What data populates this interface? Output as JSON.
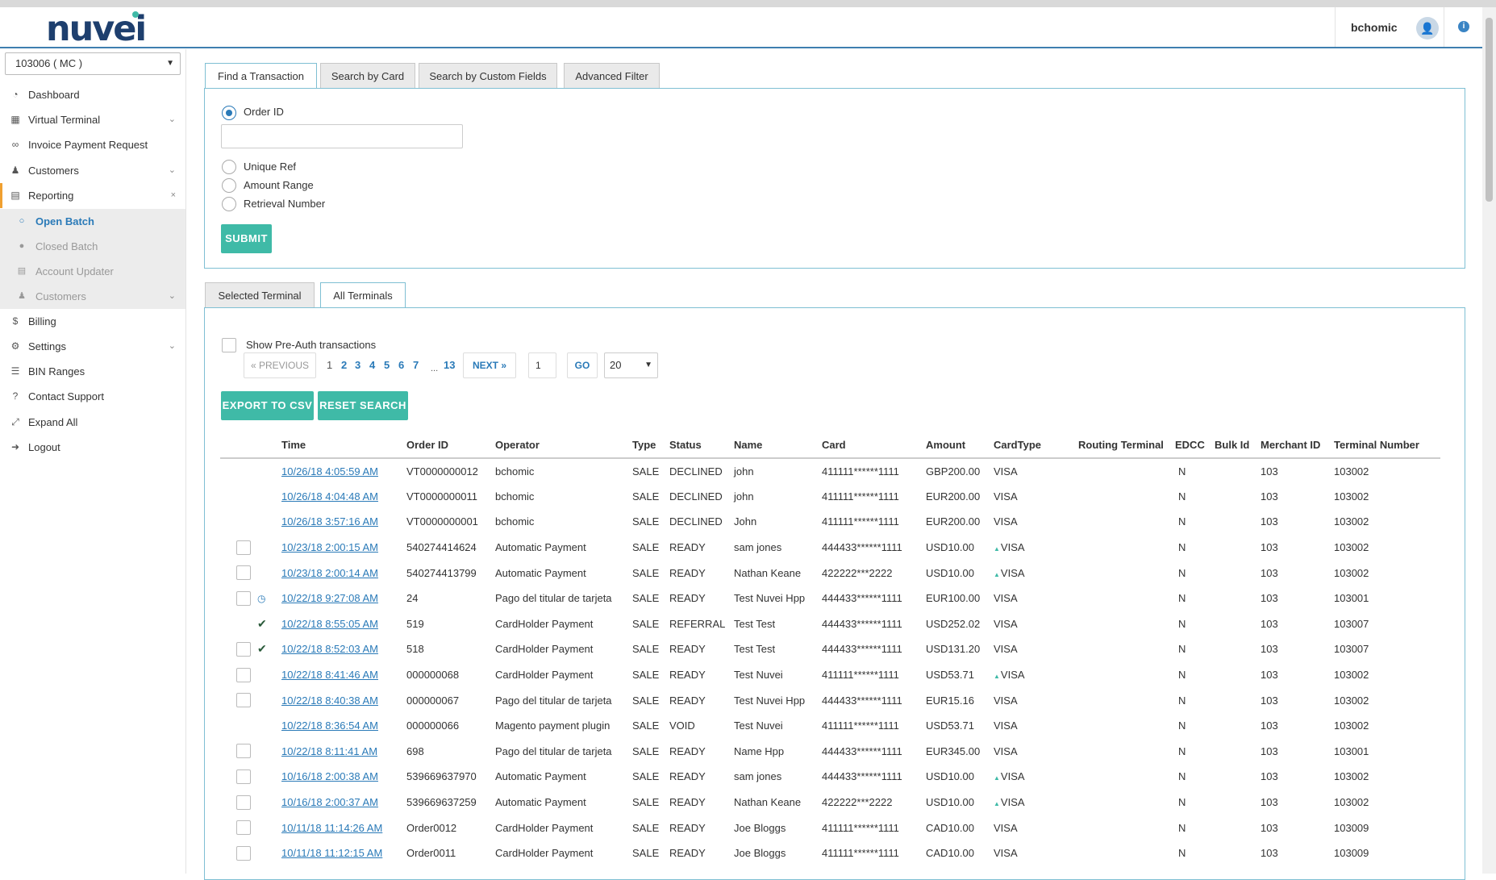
{
  "header": {
    "logo": "nuvei",
    "username": "bchomic"
  },
  "sidebar": {
    "merchant": "103006 ( MC )",
    "items": [
      {
        "label": "Dashboard",
        "icon": "dashboard-icon"
      },
      {
        "label": "Virtual Terminal",
        "icon": "calculator-icon"
      },
      {
        "label": "Invoice Payment Request",
        "icon": "link-icon"
      },
      {
        "label": "Customers",
        "icon": "users-icon"
      },
      {
        "label": "Reporting",
        "icon": "report-icon"
      },
      {
        "label": "Billing",
        "icon": "dollar-icon"
      },
      {
        "label": "Settings",
        "icon": "gears-icon"
      },
      {
        "label": "BIN Ranges",
        "icon": "list-icon"
      },
      {
        "label": "Contact Support",
        "icon": "help-icon"
      },
      {
        "label": "Expand All",
        "icon": "expand-icon"
      },
      {
        "label": "Logout",
        "icon": "logout-icon"
      }
    ],
    "reporting_sub": [
      {
        "label": "Open Batch"
      },
      {
        "label": "Closed Batch"
      },
      {
        "label": "Account Updater"
      },
      {
        "label": "Customers"
      }
    ]
  },
  "search": {
    "tabs": [
      "Find a Transaction",
      "Search by Card",
      "Search by Custom Fields",
      "Advanced Filter"
    ],
    "options": [
      "Order ID",
      "Unique Ref",
      "Amount Range",
      "Retrieval Number"
    ],
    "order_id_value": "",
    "submit": "SUBMIT"
  },
  "results": {
    "tabs": [
      "Selected Terminal",
      "All Terminals"
    ],
    "preauth_label": "Show Pre-Auth transactions",
    "pagination": {
      "previous": "« PREVIOUS",
      "pages": [
        "1",
        "2",
        "3",
        "4",
        "5",
        "6",
        "7"
      ],
      "ellipsis": "...",
      "last": "13",
      "next": "NEXT »",
      "page_input": "1",
      "go": "GO",
      "page_size": "20"
    },
    "export": "EXPORT TO CSV",
    "reset": "RESET SEARCH",
    "columns": [
      "Time",
      "Order ID",
      "Operator",
      "Type",
      "Status",
      "Name",
      "Card",
      "Amount",
      "CardType",
      "Routing Terminal",
      "EDCC",
      "Bulk Id",
      "Merchant ID",
      "Terminal Number"
    ],
    "rows": [
      {
        "chk": false,
        "mark": "",
        "time": "10/26/18 4:05:59 AM",
        "order": "VT0000000012",
        "operator": "bchomic",
        "type": "SALE",
        "status": "DECLINED",
        "name": "john",
        "card": "411111******1111",
        "amount": "GBP200.00",
        "cardtype": "VISA",
        "tri": false,
        "edcc": "N",
        "merchant": "103",
        "terminal": "103002"
      },
      {
        "chk": false,
        "mark": "",
        "time": "10/26/18 4:04:48 AM",
        "order": "VT0000000011",
        "operator": "bchomic",
        "type": "SALE",
        "status": "DECLINED",
        "name": "john",
        "card": "411111******1111",
        "amount": "EUR200.00",
        "cardtype": "VISA",
        "tri": false,
        "edcc": "N",
        "merchant": "103",
        "terminal": "103002"
      },
      {
        "chk": false,
        "mark": "",
        "time": "10/26/18 3:57:16 AM",
        "order": "VT0000000001",
        "operator": "bchomic",
        "type": "SALE",
        "status": "DECLINED",
        "name": "John",
        "card": "411111******1111",
        "amount": "EUR200.00",
        "cardtype": "VISA",
        "tri": false,
        "edcc": "N",
        "merchant": "103",
        "terminal": "103002"
      },
      {
        "chk": true,
        "mark": "",
        "time": "10/23/18 2:00:15 AM",
        "order": "540274414624",
        "operator": "Automatic Payment",
        "type": "SALE",
        "status": "READY",
        "name": "sam jones",
        "card": "444433******1111",
        "amount": "USD10.00",
        "cardtype": "VISA",
        "tri": true,
        "edcc": "N",
        "merchant": "103",
        "terminal": "103002"
      },
      {
        "chk": true,
        "mark": "",
        "time": "10/23/18 2:00:14 AM",
        "order": "540274413799",
        "operator": "Automatic Payment",
        "type": "SALE",
        "status": "READY",
        "name": "Nathan Keane",
        "card": "422222***2222",
        "amount": "USD10.00",
        "cardtype": "VISA",
        "tri": true,
        "edcc": "N",
        "merchant": "103",
        "terminal": "103002"
      },
      {
        "chk": true,
        "mark": "clock",
        "time": "10/22/18 9:27:08 AM",
        "order": "24",
        "operator": "Pago del titular de tarjeta",
        "type": "SALE",
        "status": "READY",
        "name": "Test Nuvei Hpp",
        "card": "444433******1111",
        "amount": "EUR100.00",
        "cardtype": "VISA",
        "tri": false,
        "edcc": "N",
        "merchant": "103",
        "terminal": "103001"
      },
      {
        "chk": false,
        "mark": "check",
        "time": "10/22/18 8:55:05 AM",
        "order": "519",
        "operator": "CardHolder Payment",
        "type": "SALE",
        "status": "REFERRAL",
        "name": "Test Test",
        "card": "444433******1111",
        "amount": "USD252.02",
        "cardtype": "VISA",
        "tri": false,
        "edcc": "N",
        "merchant": "103",
        "terminal": "103007"
      },
      {
        "chk": true,
        "mark": "check",
        "time": "10/22/18 8:52:03 AM",
        "order": "518",
        "operator": "CardHolder Payment",
        "type": "SALE",
        "status": "READY",
        "name": "Test Test",
        "card": "444433******1111",
        "amount": "USD131.20",
        "cardtype": "VISA",
        "tri": false,
        "edcc": "N",
        "merchant": "103",
        "terminal": "103007"
      },
      {
        "chk": true,
        "mark": "",
        "time": "10/22/18 8:41:46 AM",
        "order": "000000068",
        "operator": "CardHolder Payment",
        "type": "SALE",
        "status": "READY",
        "name": "Test Nuvei",
        "card": "411111******1111",
        "amount": "USD53.71",
        "cardtype": "VISA",
        "tri": true,
        "edcc": "N",
        "merchant": "103",
        "terminal": "103002"
      },
      {
        "chk": true,
        "mark": "",
        "time": "10/22/18 8:40:38 AM",
        "order": "000000067",
        "operator": "Pago del titular de tarjeta",
        "type": "SALE",
        "status": "READY",
        "name": "Test Nuvei Hpp",
        "card": "444433******1111",
        "amount": "EUR15.16",
        "cardtype": "VISA",
        "tri": false,
        "edcc": "N",
        "merchant": "103",
        "terminal": "103002"
      },
      {
        "chk": false,
        "mark": "",
        "time": "10/22/18 8:36:54 AM",
        "order": "000000066",
        "operator": "Magento payment plugin",
        "type": "SALE",
        "status": "VOID",
        "name": "Test Nuvei",
        "card": "411111******1111",
        "amount": "USD53.71",
        "cardtype": "VISA",
        "tri": false,
        "edcc": "N",
        "merchant": "103",
        "terminal": "103002"
      },
      {
        "chk": true,
        "mark": "",
        "time": "10/22/18 8:11:41 AM",
        "order": "698",
        "operator": "Pago del titular de tarjeta",
        "type": "SALE",
        "status": "READY",
        "name": "Name Hpp",
        "card": "444433******1111",
        "amount": "EUR345.00",
        "cardtype": "VISA",
        "tri": false,
        "edcc": "N",
        "merchant": "103",
        "terminal": "103001"
      },
      {
        "chk": true,
        "mark": "",
        "time": "10/16/18 2:00:38 AM",
        "order": "539669637970",
        "operator": "Automatic Payment",
        "type": "SALE",
        "status": "READY",
        "name": "sam jones",
        "card": "444433******1111",
        "amount": "USD10.00",
        "cardtype": "VISA",
        "tri": true,
        "edcc": "N",
        "merchant": "103",
        "terminal": "103002"
      },
      {
        "chk": true,
        "mark": "",
        "time": "10/16/18 2:00:37 AM",
        "order": "539669637259",
        "operator": "Automatic Payment",
        "type": "SALE",
        "status": "READY",
        "name": "Nathan Keane",
        "card": "422222***2222",
        "amount": "USD10.00",
        "cardtype": "VISA",
        "tri": true,
        "edcc": "N",
        "merchant": "103",
        "terminal": "103002"
      },
      {
        "chk": true,
        "mark": "",
        "time": "10/11/18 11:14:26 AM",
        "order": "Order0012",
        "operator": "CardHolder Payment",
        "type": "SALE",
        "status": "READY",
        "name": "Joe Bloggs",
        "card": "411111******1111",
        "amount": "CAD10.00",
        "cardtype": "VISA",
        "tri": false,
        "edcc": "N",
        "merchant": "103",
        "terminal": "103009"
      },
      {
        "chk": true,
        "mark": "",
        "time": "10/11/18 11:12:15 AM",
        "order": "Order0011",
        "operator": "CardHolder Payment",
        "type": "SALE",
        "status": "READY",
        "name": "Joe Bloggs",
        "card": "411111******1111",
        "amount": "CAD10.00",
        "cardtype": "VISA",
        "tri": false,
        "edcc": "N",
        "merchant": "103",
        "terminal": "103009"
      }
    ]
  }
}
